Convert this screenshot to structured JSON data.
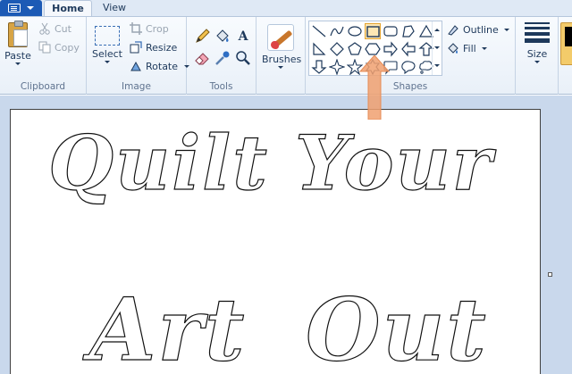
{
  "tabs": {
    "home": "Home",
    "view": "View"
  },
  "clipboard": {
    "label": "Clipboard",
    "paste": "Paste",
    "cut": "Cut",
    "copy": "Copy"
  },
  "image": {
    "label": "Image",
    "select": "Select",
    "crop": "Crop",
    "resize": "Resize",
    "rotate": "Rotate"
  },
  "tools": {
    "label": "Tools",
    "text_tool_glyph": "A"
  },
  "brushes": {
    "label": "Brushes"
  },
  "shapes": {
    "label": "Shapes",
    "outline": "Outline",
    "fill": "Fill",
    "selected_shape": "rectangle"
  },
  "size": {
    "label": "Size"
  },
  "canvas_text": {
    "line1_word1": "Quilt",
    "line1_word2": "Your",
    "line2_word1": "Art",
    "line2_word2": "Out"
  },
  "colors": {
    "file_button": "#1c5ab5",
    "arrow_annotation": "#f0a070",
    "selection_highlight": "#fde7b4"
  },
  "icons": [
    "clipboard-icon",
    "scissors-icon",
    "copy-icon",
    "select-icon",
    "crop-icon",
    "resize-icon",
    "rotate-icon",
    "pencil-icon",
    "fill-icon",
    "text-icon",
    "eraser-icon",
    "color-picker-icon",
    "magnifier-icon",
    "brush-icon",
    "outline-icon",
    "fill-bucket-icon",
    "size-icon"
  ]
}
